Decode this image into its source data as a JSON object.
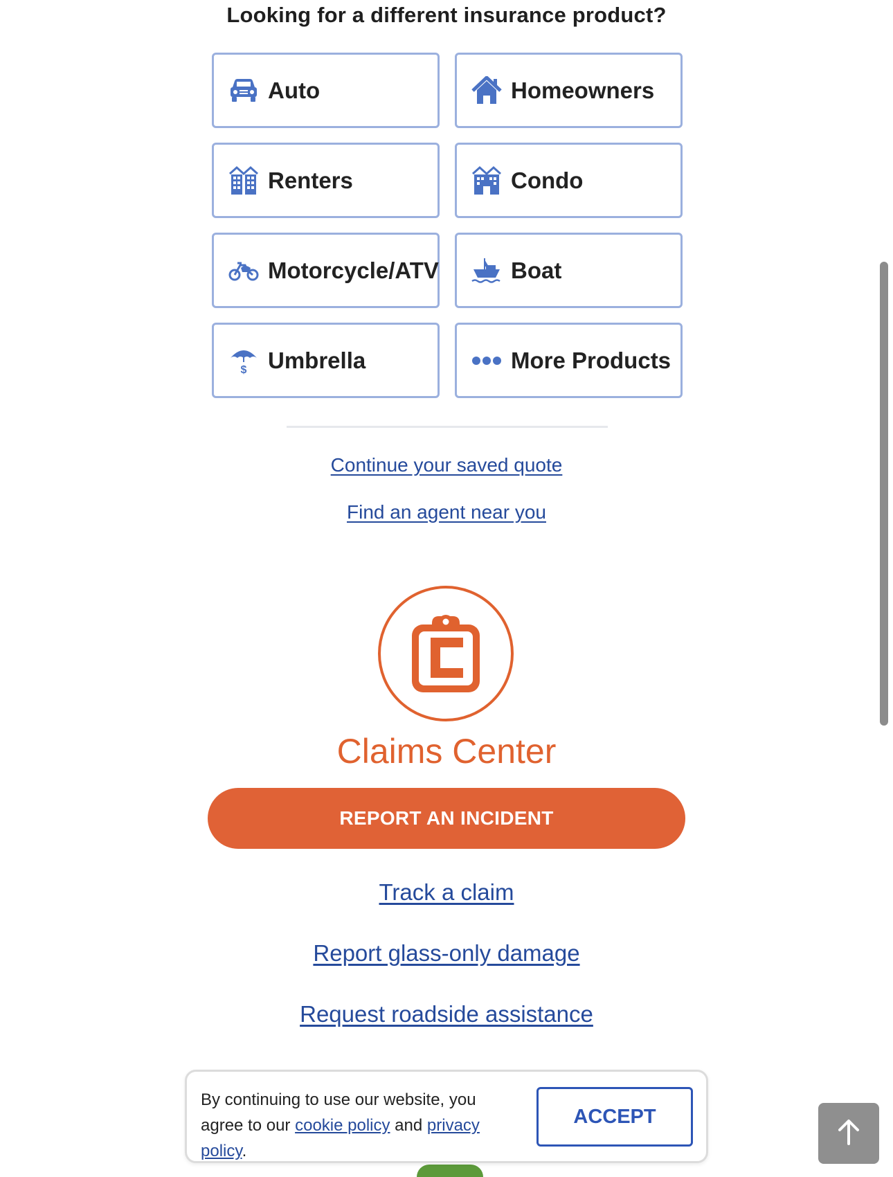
{
  "heading": "Looking for a different insurance product?",
  "products": [
    {
      "label": "Auto",
      "icon": "car-icon"
    },
    {
      "label": "Homeowners",
      "icon": "house-icon"
    },
    {
      "label": "Renters",
      "icon": "apartment-building-icon"
    },
    {
      "label": "Condo",
      "icon": "condo-building-icon"
    },
    {
      "label": "Motorcycle/ATV",
      "icon": "motorcycle-icon"
    },
    {
      "label": "Boat",
      "icon": "boat-icon"
    },
    {
      "label": "Umbrella",
      "icon": "umbrella-dollar-icon"
    },
    {
      "label": "More Products",
      "icon": "more-dots-icon"
    }
  ],
  "quote_links": {
    "saved_quote": "Continue your saved quote",
    "find_agent": "Find an agent near you"
  },
  "claims": {
    "title": "Claims Center",
    "report_button": "REPORT AN INCIDENT",
    "links": {
      "track": "Track a claim",
      "glass": "Report glass-only damage",
      "roadside": "Request roadside assistance"
    }
  },
  "cookie_banner": {
    "text_before": "By continuing to use our website, you agree to our ",
    "cookie_link": "cookie policy",
    "text_middle": " and ",
    "privacy_link": "privacy policy",
    "text_after": ".",
    "accept_label": "ACCEPT"
  },
  "colors": {
    "accent_blue": "#2d55b6",
    "link_blue": "#254a9b",
    "card_border": "#9bb0de",
    "claims_orange": "#e0622f"
  }
}
